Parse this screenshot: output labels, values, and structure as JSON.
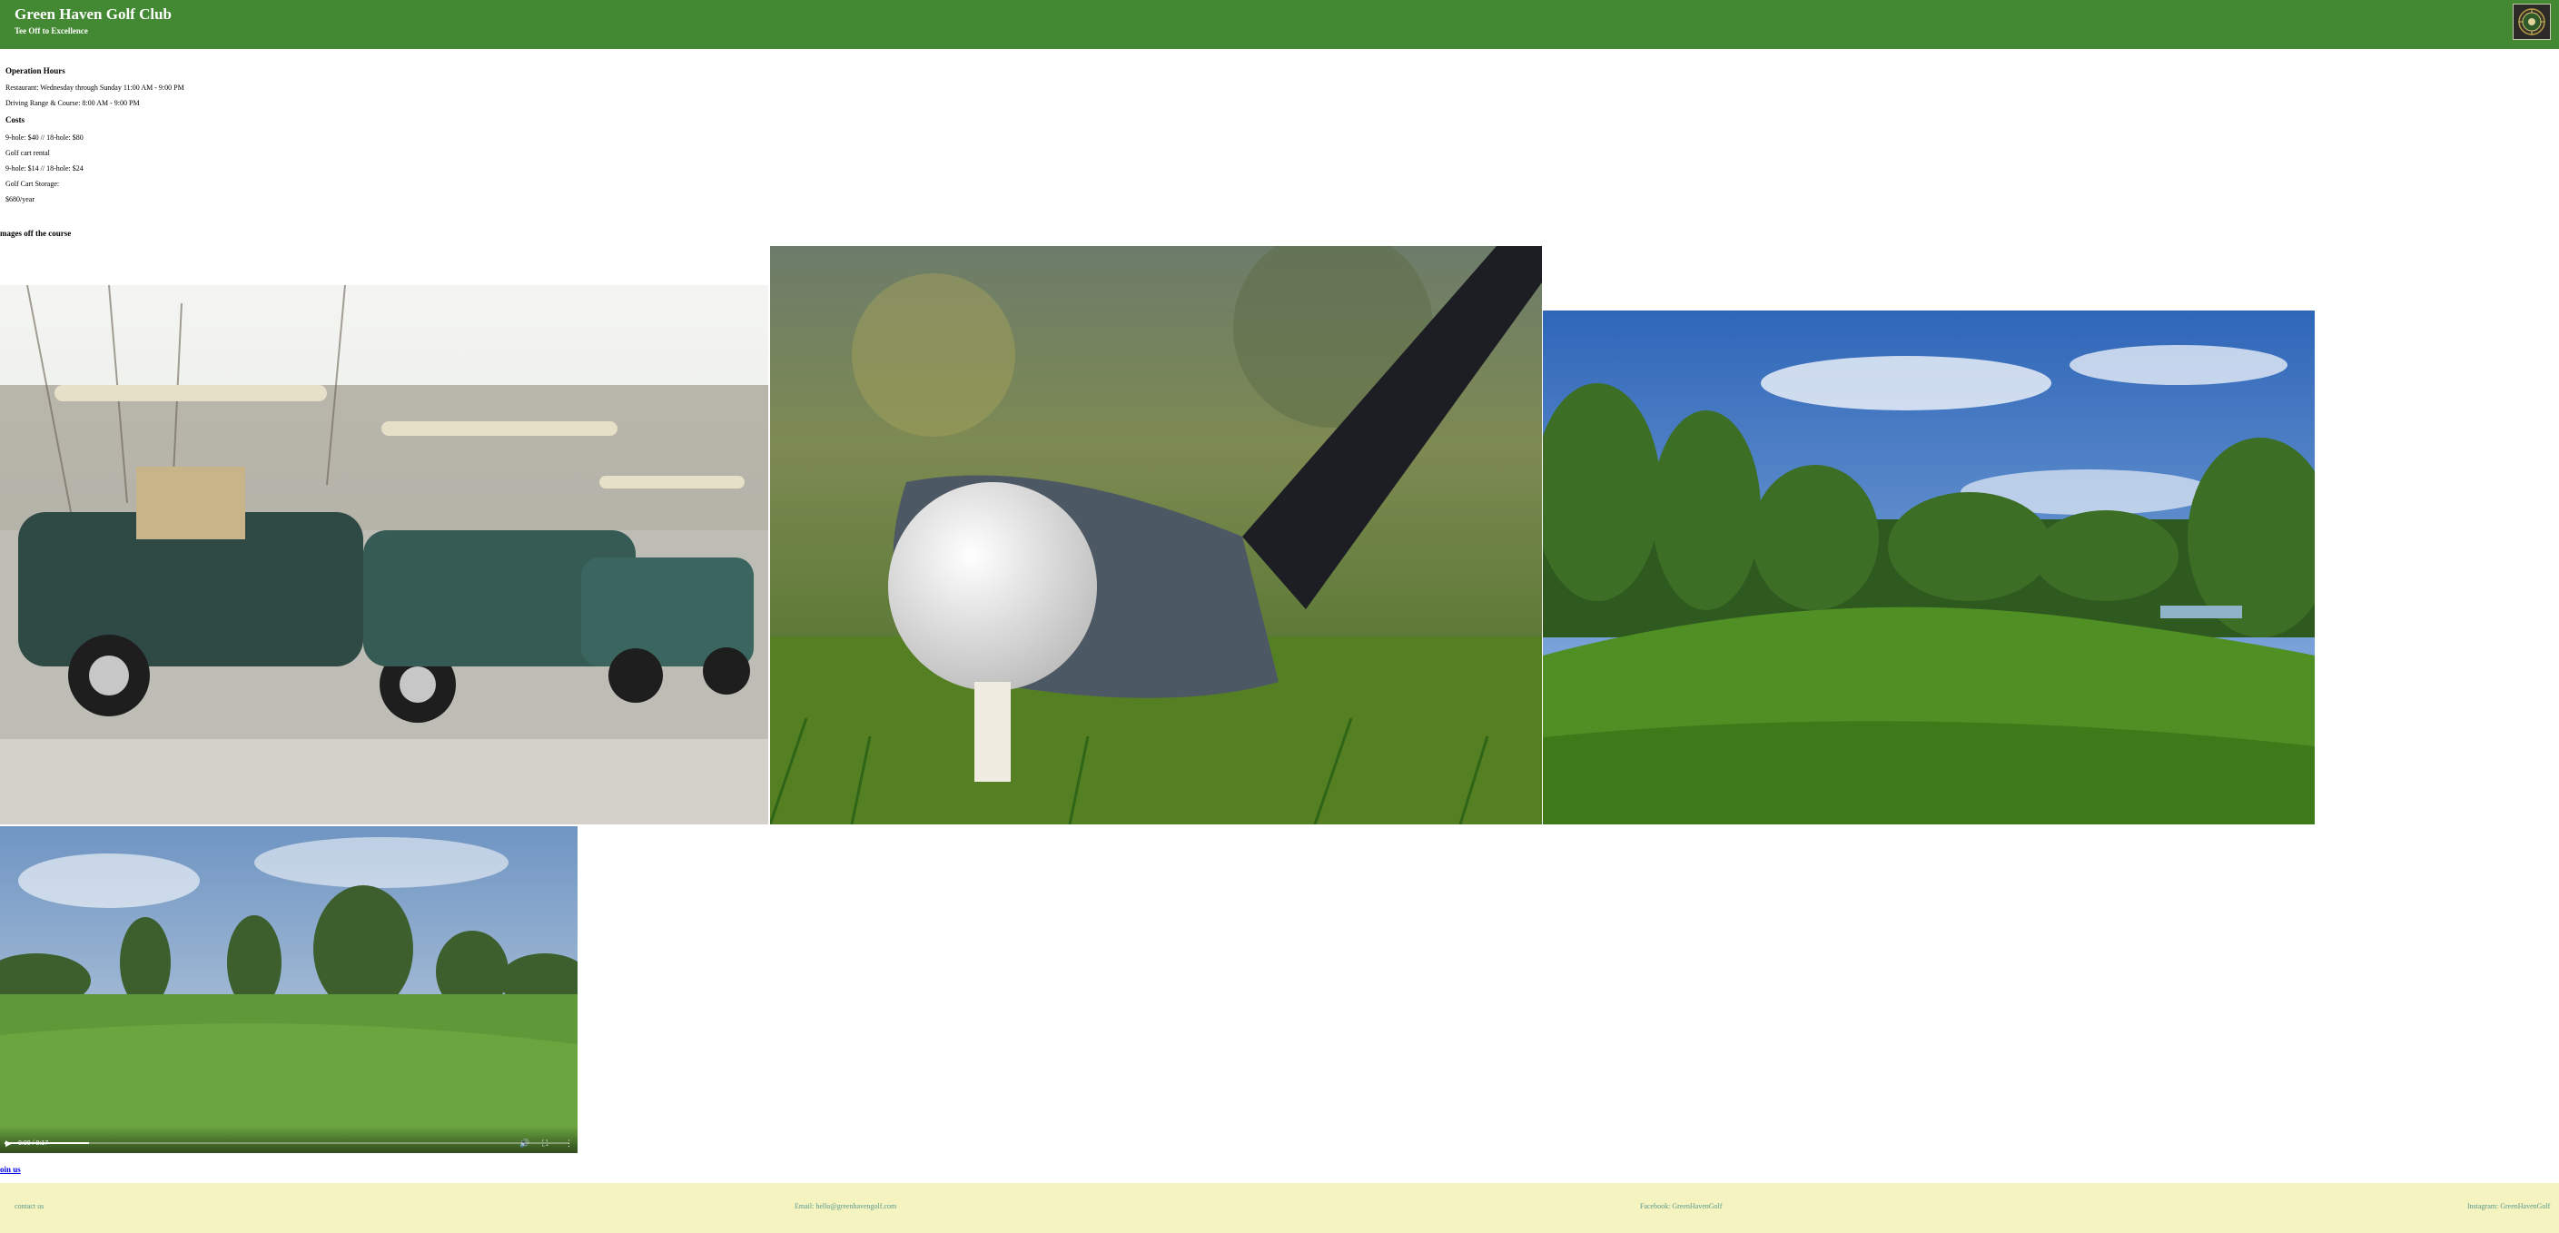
{
  "header": {
    "title": "Green Haven Golf Club",
    "subtitle": "Tee Off to Excellence",
    "logo": "club-crest-logo",
    "background": "#438933"
  },
  "info": {
    "hours_heading": "Operation Hours",
    "restaurant_hours": "Restaurant: Wednesday through Sunday 11:00 AM - 9:00 PM",
    "range_hours": "Driving Range & Course: 8:00 AM - 9:00 PM",
    "costs_heading": "Costs",
    "green_fees": "9-hole: $40 // 18-hole: $80",
    "cart_rental_label": "Golf cart rental",
    "cart_rental_fees": "9-hole: $14 // 18-hole: $24",
    "cart_storage_label": "Golf Cart Storage:",
    "cart_storage_fee": "$680/year"
  },
  "gallery": {
    "title": "mages off the course",
    "photos": [
      "golf-carts-photo",
      "driver-and-ball-photo",
      "course-landscape-photo"
    ]
  },
  "video": {
    "time": "0:00 / 0:17",
    "progress": 0.15,
    "play_icon": "play-icon",
    "volume_icon": "volume-icon",
    "fullscreen_icon": "fullscreen-icon",
    "menu_icon": "more-options-icon"
  },
  "join_link": "oin us",
  "footer": {
    "contact": "contact us",
    "email": "Email: hello@greenhavengolf.com",
    "facebook": "Facebook: GreenHavenGolf",
    "instagram": "Instagram: GreenHavenGolf",
    "background": "#f5f3c0",
    "text_color": "#5a9a8e"
  }
}
